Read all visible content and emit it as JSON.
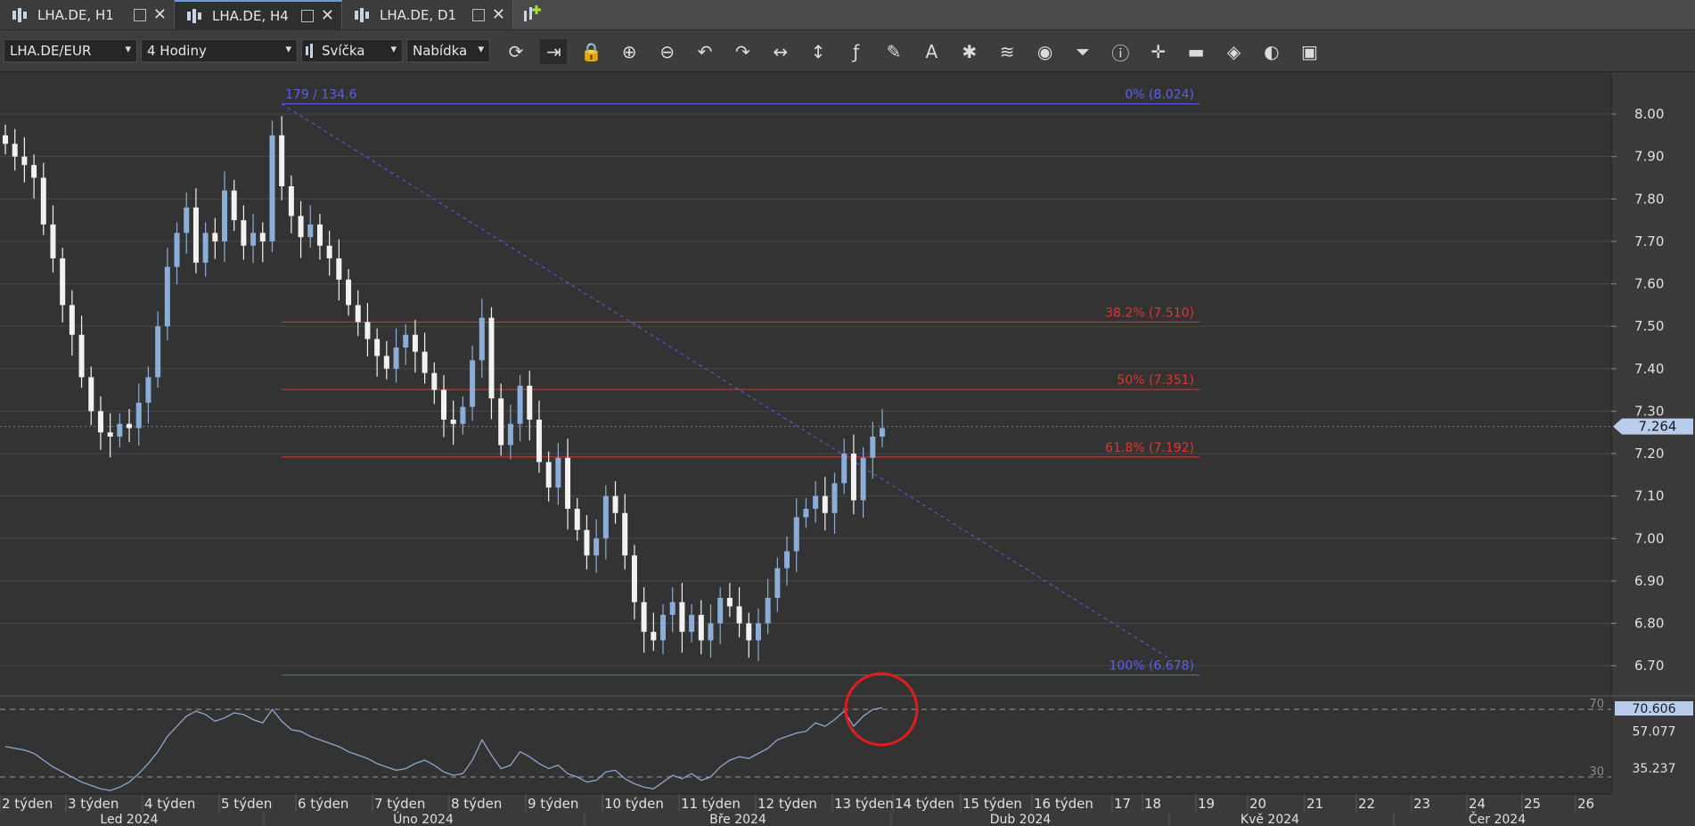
{
  "tabs": [
    {
      "label": "LHA.DE, H1",
      "active": false
    },
    {
      "label": "LHA.DE, H4",
      "active": true
    },
    {
      "label": "LHA.DE, D1",
      "active": false
    }
  ],
  "add_tab_icon": "add-chart-icon",
  "toolbar": {
    "instrument": "LHA.DE/EUR",
    "period": "4 Hodiny",
    "chart_type": "Svíčka",
    "price_side": "Nabídka",
    "tools": [
      "refresh-icon",
      "shift-chart-icon",
      "lock-icon",
      "zoom-in-icon",
      "zoom-out-icon",
      "undo-icon",
      "redo-icon",
      "horizontal-scale-icon",
      "vertical-scale-icon",
      "formula-icon",
      "pencil-icon",
      "text-tool-icon",
      "pattern-icon",
      "layers-icon",
      "eye-icon",
      "alerts-icon",
      "info-icon",
      "crosshair-icon",
      "volume-bars-icon",
      "paint-bucket-icon",
      "theme-icon",
      "save-icon"
    ]
  },
  "colors": {
    "background": "#333333",
    "grid": "#474747",
    "candle_up": "#8aaed8",
    "candle_down": "#f2f2f2",
    "fib_extreme": "#5a5ff0",
    "fib_mid": "#e2352f",
    "rsi_line": "#8ea6cc",
    "price_tag": "#b8ccec"
  },
  "chart_data": {
    "type": "candlestick",
    "ylim": [
      6.65,
      8.04
    ],
    "yticks": [
      "8.00",
      "7.90",
      "7.80",
      "7.70",
      "7.60",
      "7.50",
      "7.40",
      "7.30",
      "7.20",
      "7.10",
      "7.00",
      "6.90",
      "6.80",
      "6.70"
    ],
    "current_price": "7.264",
    "fibonacci": {
      "range_label": "179 / 134.6",
      "levels": [
        {
          "label": "0% (8.024)",
          "value": 8.024
        },
        {
          "label": "38.2% (7.510)",
          "value": 7.51
        },
        {
          "label": "50% (7.351)",
          "value": 7.351
        },
        {
          "label": "61.8% (7.192)",
          "value": 7.192
        },
        {
          "label": "100% (6.678)",
          "value": 6.678
        }
      ]
    },
    "close_path": [
      7.93,
      7.9,
      7.88,
      7.85,
      7.74,
      7.66,
      7.55,
      7.48,
      7.38,
      7.3,
      7.25,
      7.24,
      7.27,
      7.26,
      7.32,
      7.38,
      7.5,
      7.64,
      7.72,
      7.78,
      7.65,
      7.72,
      7.7,
      7.82,
      7.75,
      7.69,
      7.72,
      7.7,
      7.95,
      7.83,
      7.76,
      7.71,
      7.74,
      7.69,
      7.66,
      7.61,
      7.55,
      7.51,
      7.47,
      7.43,
      7.4,
      7.45,
      7.48,
      7.44,
      7.39,
      7.35,
      7.28,
      7.27,
      7.31,
      7.42,
      7.52,
      7.33,
      7.22,
      7.27,
      7.36,
      7.28,
      7.18,
      7.12,
      7.19,
      7.07,
      7.02,
      6.96,
      7.0,
      7.1,
      7.06,
      6.96,
      6.85,
      6.78,
      6.76,
      6.82,
      6.85,
      6.78,
      6.82,
      6.76,
      6.8,
      6.86,
      6.84,
      6.8,
      6.76,
      6.8,
      6.86,
      6.93,
      6.97,
      7.05,
      7.07,
      7.1,
      7.06,
      7.13,
      7.2,
      7.09,
      7.19,
      7.24,
      7.26
    ],
    "rsi": {
      "levels": [
        "70",
        "30"
      ],
      "scale_labels": [
        "70.606",
        "57.077",
        "35.237"
      ],
      "current": "70.606",
      "ylim": [
        20,
        78
      ],
      "values": [
        48,
        47,
        46,
        44,
        40,
        36,
        33,
        30,
        27,
        25,
        23,
        22,
        24,
        27,
        32,
        38,
        45,
        54,
        60,
        66,
        69,
        67,
        63,
        65,
        68,
        67,
        64,
        62,
        70,
        63,
        58,
        57,
        54,
        52,
        50,
        48,
        45,
        43,
        41,
        38,
        36,
        34,
        35,
        38,
        40,
        37,
        33,
        31,
        32,
        40,
        52,
        43,
        35,
        37,
        45,
        42,
        38,
        35,
        37,
        32,
        30,
        27,
        28,
        33,
        34,
        29,
        26,
        24,
        23,
        27,
        31,
        29,
        32,
        28,
        30,
        36,
        40,
        42,
        41,
        44,
        47,
        52,
        54,
        56,
        57,
        62,
        60,
        64,
        69,
        60,
        66,
        70,
        71
      ]
    },
    "x_labels_top": [
      "2 týden",
      "3 týden",
      "4 týden",
      "5 týden",
      "6 týden",
      "7 týden",
      "8 týden",
      "9 týden",
      "10 týden",
      "11 týden",
      "12 týden",
      "13 týden",
      "14 týden",
      "15 týden",
      "16 týden",
      "17",
      "18",
      "19",
      "20",
      "21",
      "22",
      "23",
      "24",
      "25",
      "26"
    ],
    "x_labels_bottom": [
      "Led 2024",
      "Úno 2024",
      "Bře 2024",
      "Dub 2024",
      "Kvě 2024",
      "Čer 2024"
    ]
  }
}
